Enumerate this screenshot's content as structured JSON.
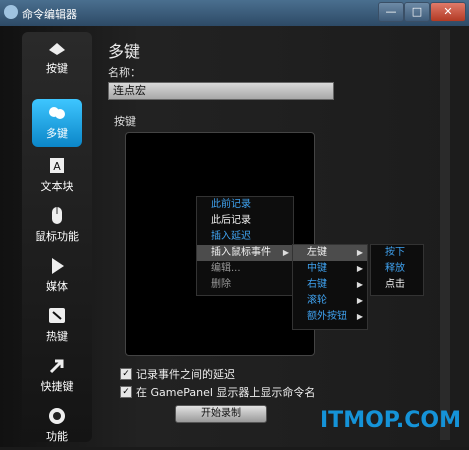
{
  "window": {
    "title": "命令编辑器",
    "min_label": "—",
    "max_label": "□",
    "close_label": "✕"
  },
  "sidebar": {
    "items": [
      {
        "label": "按键",
        "icon": "mouse-key-icon"
      },
      {
        "label": "多键",
        "icon": "multikey-icon",
        "active": true
      },
      {
        "label": "文本块",
        "icon": "text-block-icon"
      },
      {
        "label": "鼠标功能",
        "icon": "mouse-icon"
      },
      {
        "label": "媒体",
        "icon": "play-icon"
      },
      {
        "label": "热键",
        "icon": "hotkey-icon"
      },
      {
        "label": "快捷键",
        "icon": "shortcut-arrow-icon"
      },
      {
        "label": "功能",
        "icon": "function-gear-icon"
      }
    ]
  },
  "main": {
    "heading": "多键",
    "name_label": "名称：",
    "name_value": "连点宏",
    "keys_label": "按键",
    "context_menu": [
      {
        "label": "此前记录",
        "style": "blue"
      },
      {
        "label": "此后记录",
        "style": "white"
      },
      {
        "label": "插入延迟",
        "style": "blue"
      },
      {
        "label": "插入鼠标事件",
        "style": "white",
        "submenu": true
      },
      {
        "label": "编辑...",
        "style": "grey"
      },
      {
        "label": "删除",
        "style": "grey"
      }
    ],
    "submenu": [
      {
        "label": "左键",
        "style": "white",
        "submenu": true
      },
      {
        "label": "中键",
        "style": "blue",
        "submenu": true
      },
      {
        "label": "右键",
        "style": "blue",
        "submenu": true
      },
      {
        "label": "滚轮",
        "style": "blue",
        "submenu": true
      },
      {
        "label": "额外按钮",
        "style": "blue",
        "submenu": true
      }
    ],
    "submenu2": [
      {
        "label": "按下",
        "style": "blue"
      },
      {
        "label": "释放",
        "style": "blue"
      },
      {
        "label": "点击",
        "style": "white"
      }
    ],
    "check1_label": "记录事件之间的延迟",
    "check2_label": "在 GamePanel 显示器上显示命令名",
    "record_button": "开始录制",
    "submenu_arrow": "▶",
    "check_mark": "✓"
  },
  "watermark": "ITMOP.COM",
  "colors": {
    "accent": "#1ea7f0",
    "menu_blue": "#3fa2f0"
  }
}
